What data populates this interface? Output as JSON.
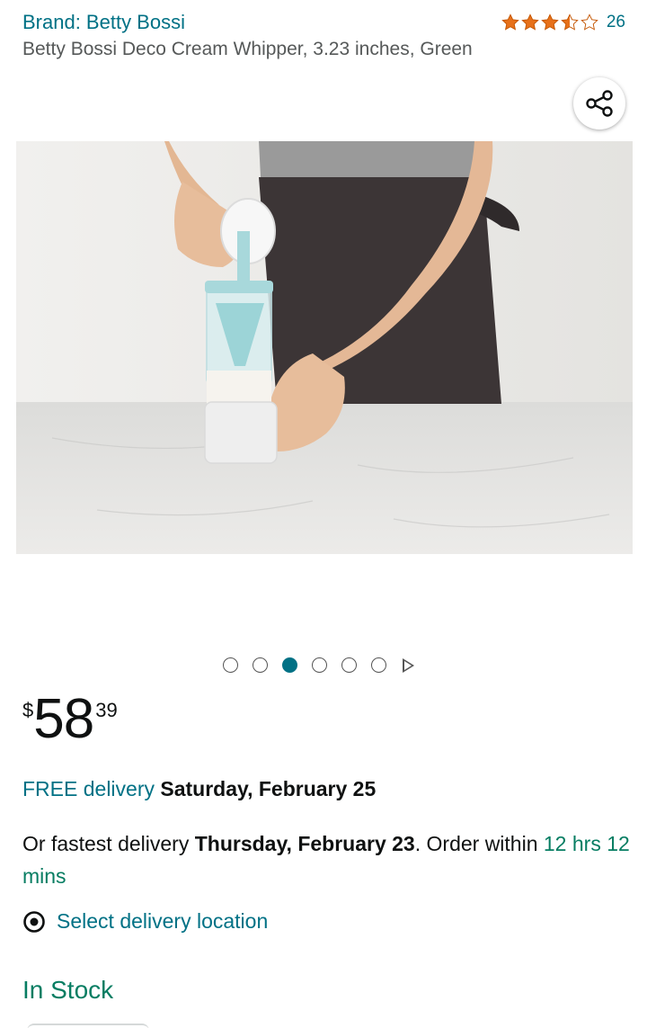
{
  "product": {
    "brand": "Brand: Betty Bossi",
    "title": "Betty Bossi Deco Cream Whipper, 3.23 inches, Green",
    "rating": {
      "stars": 3.5,
      "max_stars": 5,
      "count": "26"
    },
    "share_icon": "share-icon",
    "image_alt": "Woman pressing down on a cream whipper on a marble countertop"
  },
  "carousel": {
    "total": 6,
    "active_index": 2
  },
  "price": {
    "symbol": "$",
    "whole": "58",
    "fraction": "39"
  },
  "delivery": {
    "free_label": "FREE delivery",
    "free_date": "Saturday, February 25",
    "fastest_prefix": "Or fastest delivery ",
    "fastest_date": "Thursday, February 23",
    "order_within_prefix": ". Order within ",
    "order_within_time": "12 hrs 12 mins"
  },
  "location": {
    "icon": "location-pin-icon",
    "label": "Select delivery location"
  },
  "stock": {
    "status": "In Stock"
  },
  "colors": {
    "link": "#007185",
    "success": "#067d62",
    "star": "#e7711b",
    "text": "#0f1111",
    "muted": "#565959"
  }
}
